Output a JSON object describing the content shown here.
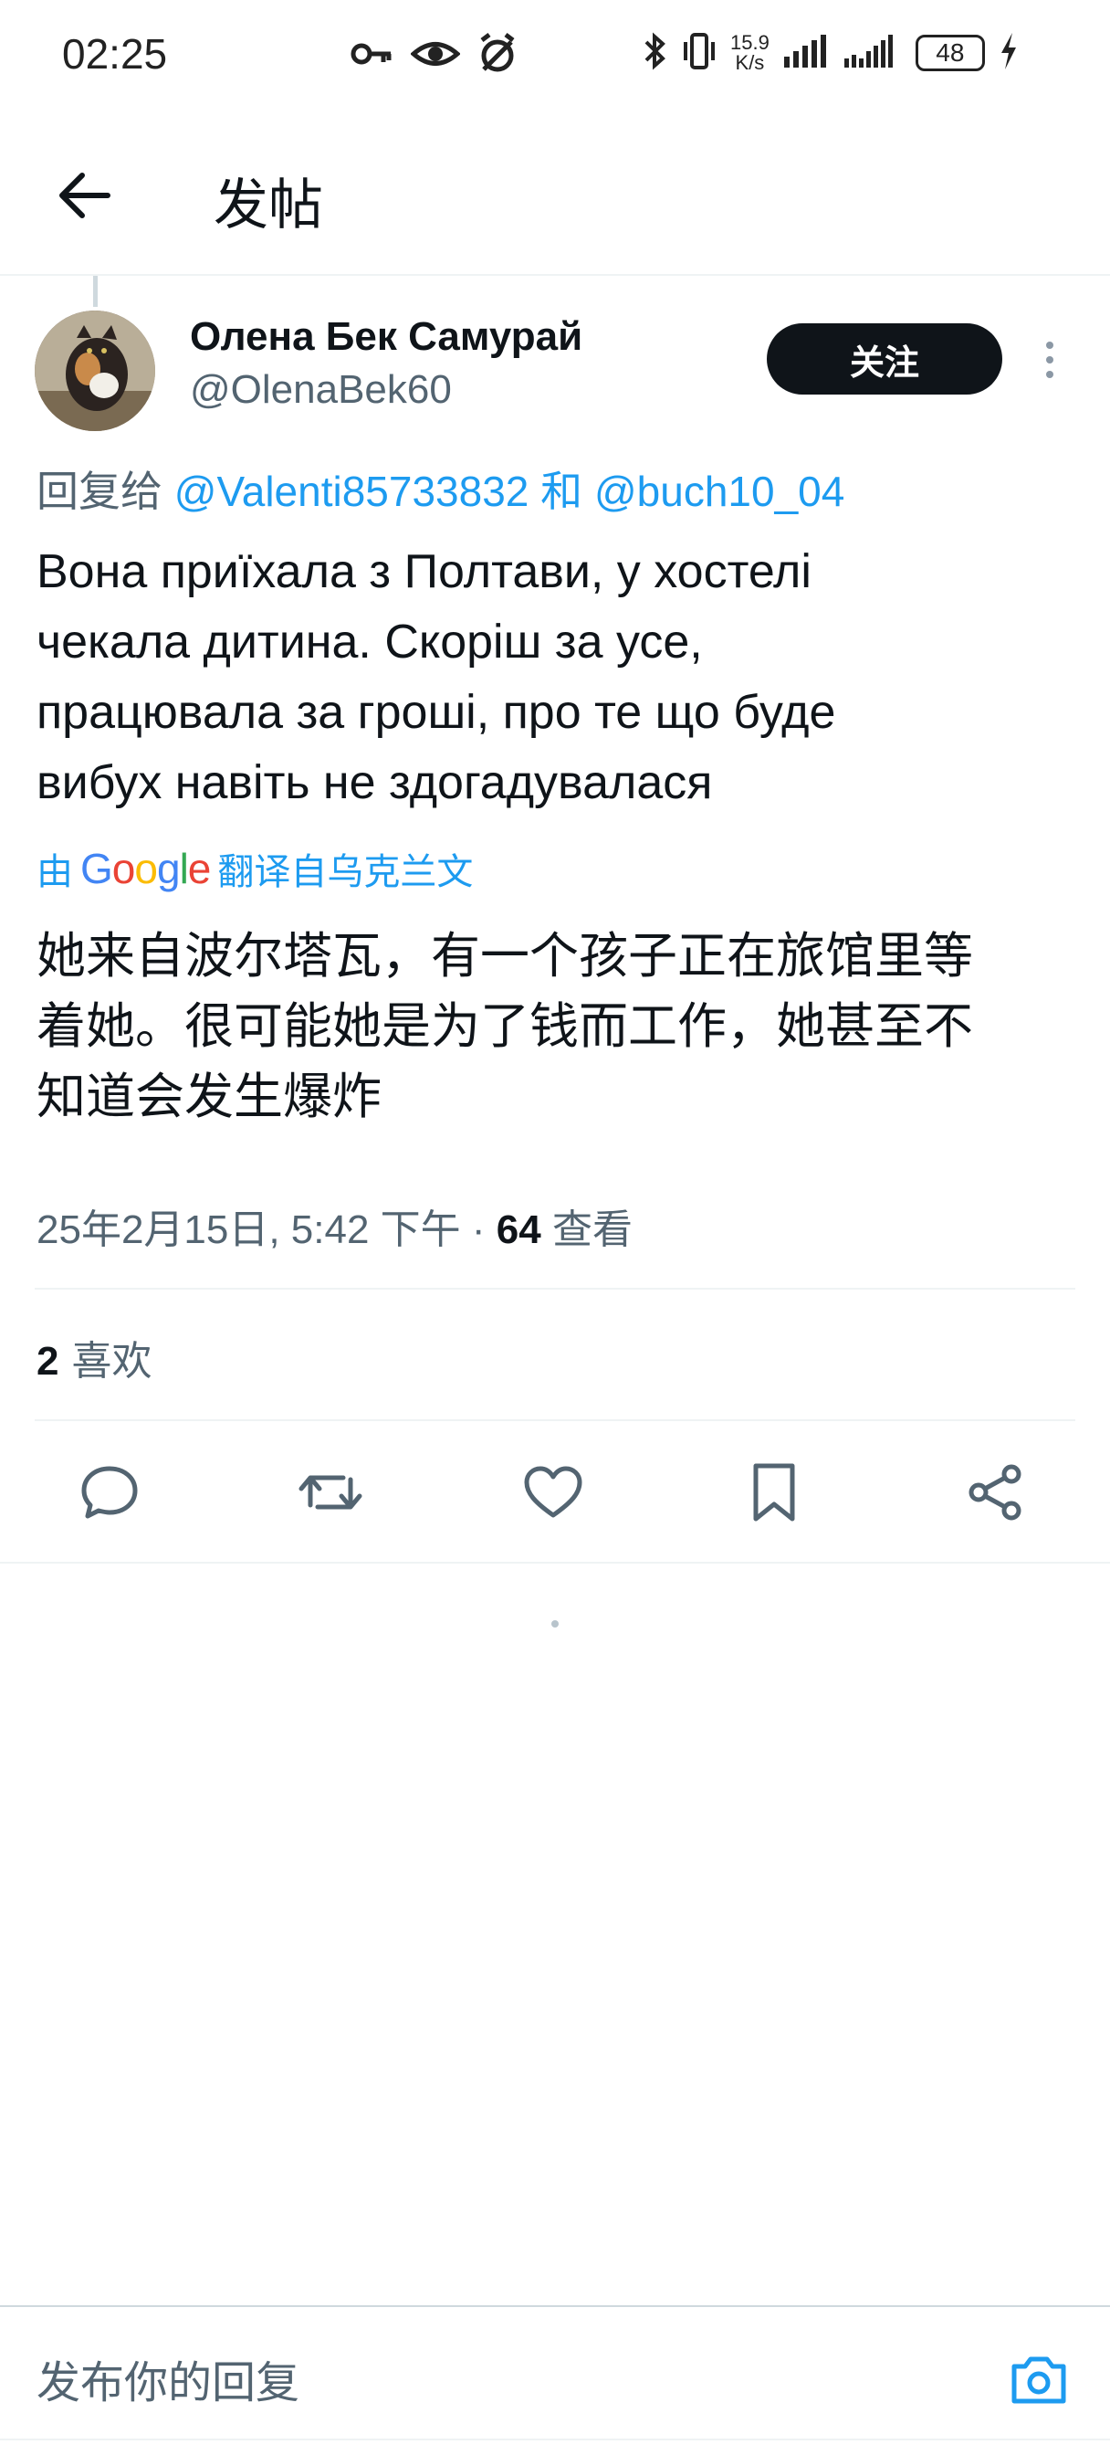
{
  "status_bar": {
    "time": "02:25",
    "net_speed_value": "15.9",
    "net_speed_unit": "K/s",
    "battery": "48",
    "icons": [
      "key-icon",
      "eye-icon",
      "alarm-off-icon",
      "bluetooth-icon",
      "vibrate-icon",
      "signal-icon",
      "signal-icon",
      "charging-icon"
    ]
  },
  "header": {
    "title": "发帖"
  },
  "post": {
    "author_name": "Олена Бек Самурай",
    "author_handle": "@OlenaBek60",
    "follow_label": "关注",
    "reply_prefix": "回复给",
    "reply_mention_1": "@Valenti85733832",
    "reply_and": "和",
    "reply_mention_2": "@buch10_04",
    "text_line_1": "Вона приїхала  з Полтави, у хостелі",
    "text_line_2": "чекала дитина. Скоріш за усе,",
    "text_line_3": "працювала  за гроші, про те що буде",
    "text_line_4": "вибух навіть не здогадувалася",
    "translated_by_prefix": "由",
    "translated_by_brand": "Google",
    "translated_by_suffix": "翻译自乌克兰文",
    "translated_line_1": "她来自波尔塔瓦，有一个孩子正在旅馆里等",
    "translated_line_2": "着她。很可能她是为了钱而工作，她甚至不",
    "translated_line_3": "知道会发生爆炸",
    "timestamp": "25年2月15日, 5:42 下午 · ",
    "views_count": "64",
    "views_label": " 查看",
    "likes_count": "2",
    "likes_label": " 喜欢"
  },
  "actions": {
    "reply": "reply-icon",
    "retweet": "retweet-icon",
    "like": "heart-icon",
    "bookmark": "bookmark-icon",
    "share": "share-icon"
  },
  "reply_bar": {
    "placeholder": "发布你的回复"
  },
  "colors": {
    "link": "#1d9bf0",
    "secondary_text": "#536471",
    "primary_text": "#0f1419",
    "google_blue": "#4285F4",
    "google_red": "#EA4335",
    "google_yellow": "#FBBC05",
    "google_green": "#34A853"
  }
}
